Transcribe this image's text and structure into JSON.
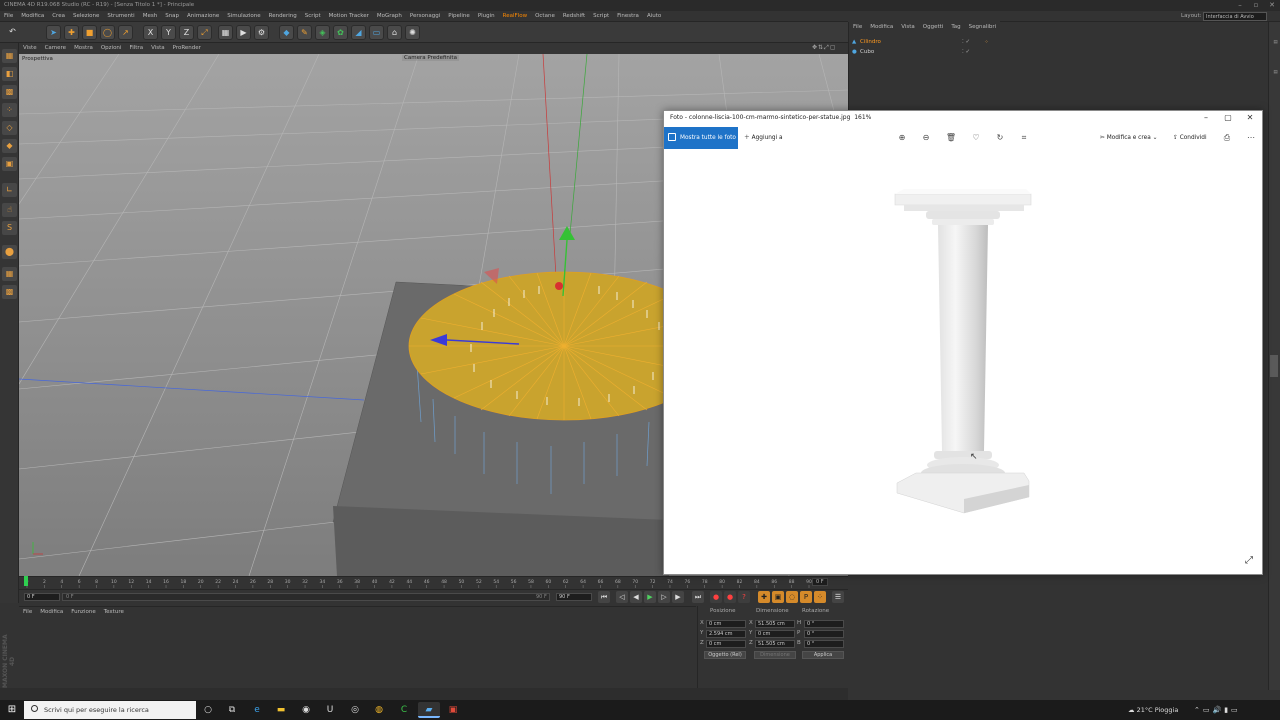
{
  "app": {
    "title": "CINEMA 4D R19.068 Studio (RC - R19) - [Senza Titolo 1 *] - Principale",
    "menu": [
      "File",
      "Modifica",
      "Crea",
      "Selezione",
      "Strumenti",
      "Mesh",
      "Snap",
      "Animazione",
      "Simulazione",
      "Rendering",
      "Script",
      "Motion Tracker",
      "MoGraph",
      "Personaggi",
      "Pipeline",
      "Plugin",
      "RealFlow",
      "Octane",
      "Redshift",
      "Script",
      "Finestra",
      "Aiuto"
    ],
    "menu_highlight": "RealFlow",
    "layout_label": "Layout:",
    "layout_value": "Interfaccia di Avvio",
    "accent": "#ff8a00"
  },
  "toolbar": {
    "icons": [
      "undo-icon",
      "select-icon",
      "move-icon",
      "scale-icon",
      "rotate-icon",
      "live-select-icon",
      "x-axis-icon",
      "y-axis-icon",
      "z-axis-icon",
      "coord-system-icon",
      "render-view-icon",
      "render-picture-icon",
      "render-settings-icon",
      "cube-icon",
      "pen-icon",
      "subdivision-icon",
      "array-icon",
      "deformer-icon",
      "floor-icon",
      "camera-icon",
      "light-icon"
    ],
    "axis_labels": [
      "X",
      "Y",
      "Z"
    ]
  },
  "viewport": {
    "menu": [
      "Viste",
      "Camere",
      "Mostra",
      "Opzioni",
      "Filtra",
      "Vista",
      "ProRender"
    ],
    "view_label": "Prospettiva",
    "camera_label": "Camera Predefinita"
  },
  "timeline": {
    "ticks": [
      "0",
      "2",
      "4",
      "6",
      "8",
      "10",
      "12",
      "14",
      "16",
      "18",
      "20",
      "22",
      "24",
      "26",
      "28",
      "30",
      "32",
      "34",
      "36",
      "38",
      "40",
      "42",
      "44",
      "46",
      "48",
      "50",
      "52",
      "54",
      "56",
      "58",
      "60",
      "62",
      "64",
      "66",
      "68",
      "70",
      "72",
      "74",
      "76",
      "78",
      "80",
      "82",
      "84",
      "86",
      "88",
      "90"
    ],
    "current_frame": "0 F",
    "start_field": "0 F",
    "min_field": "0 F",
    "max_field": "90 F",
    "end_field": "90 F"
  },
  "material_panel": {
    "menu": [
      "File",
      "Modifica",
      "Funzione",
      "Texture"
    ]
  },
  "coordinates": {
    "headers": [
      "Posizione",
      "Dimensione",
      "Rotazione"
    ],
    "rows": [
      {
        "axis": "X",
        "pos": "0 cm",
        "size_axis": "X",
        "size": "51.505 cm",
        "rot_axis": "H",
        "rot": "0 °"
      },
      {
        "axis": "Y",
        "pos": "2.594 cm",
        "size_axis": "Y",
        "size": "0 cm",
        "rot_axis": "P",
        "rot": "0 °"
      },
      {
        "axis": "Z",
        "pos": "0 cm",
        "size_axis": "Z",
        "size": "51.505 cm",
        "rot_axis": "B",
        "rot": "0 °"
      }
    ],
    "mode": "Oggetto (Rel)",
    "size_mode": "Dimensione",
    "apply": "Applica"
  },
  "maxon_logo": "MAXON CINEMA 4D",
  "object_manager": {
    "menu": [
      "File",
      "Modifica",
      "Vista",
      "Oggetti",
      "Tag",
      "Segnalibri"
    ],
    "objects": [
      {
        "name": "Cilindro",
        "color": "#ff9a20"
      },
      {
        "name": "Cubo",
        "color": "#cfcfcf"
      }
    ]
  },
  "photos": {
    "title": "Foto - colonne-liscia-100-cm-marmo-sintetico-per-statue.jpg",
    "zoom": "161%",
    "show_all": "Mostra tutte le foto",
    "add_to": "Aggiungi a",
    "edit": "Modifica e crea",
    "share": "Condividi",
    "tools": [
      "zoom-in-icon",
      "zoom-out-icon",
      "delete-icon",
      "heart-icon",
      "rotate-icon",
      "crop-icon"
    ]
  },
  "taskbar": {
    "search_placeholder": "Scrivi qui per eseguire la ricerca",
    "weather": "21°C Pioggia",
    "apps": [
      "cortana-icon",
      "task-view-icon",
      "edge-icon",
      "file-explorer-icon",
      "obs-icon",
      "unreal-icon",
      "steam-icon",
      "chrome-icon",
      "camtasia-icon",
      "photos-app-icon",
      "cinema4d-icon"
    ]
  }
}
